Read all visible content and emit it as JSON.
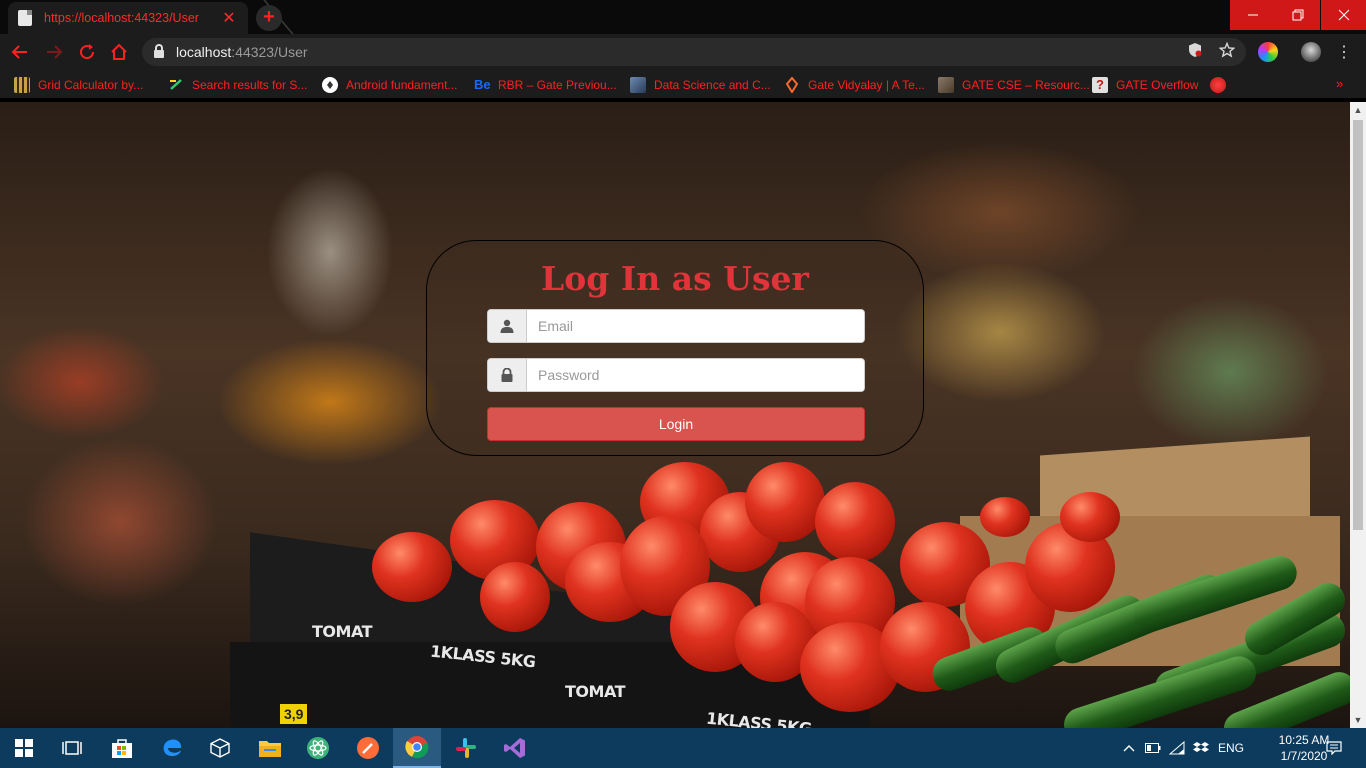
{
  "browser": {
    "tab_title": "https://localhost:44323/User",
    "tab_close": "✕",
    "new_tab": "+",
    "url_host": "localhost",
    "url_rest": ":44323/User",
    "bookmarks": [
      {
        "label": "Grid Calculator by...",
        "color": "#c8a24a"
      },
      {
        "label": "Search results for S...",
        "color": "#2ecc71"
      },
      {
        "label": "Android fundament...",
        "color": "#ffffff"
      },
      {
        "label": "RBR – Gate Previou...",
        "color": "#1769ff"
      },
      {
        "label": "Data Science and C...",
        "color": "#6a8caf"
      },
      {
        "label": "Gate Vidyalay | A Te...",
        "color": "#ff6a2a"
      },
      {
        "label": "GATE CSE – Resourc...",
        "color": "#8a7a6a"
      },
      {
        "label": "GATE Overflow",
        "color": "#e0e0e0"
      }
    ],
    "bookmarks_more": "»"
  },
  "login": {
    "title": "Log In as User",
    "email_placeholder": "Email",
    "password_placeholder": "Password",
    "button_label": "Login",
    "accent": "#e0333a",
    "button_color": "#d9534f"
  },
  "background": {
    "crate_labels": [
      "TOMAT",
      "1KLASS 5KG",
      "TOMAT",
      "1KLASS 5KG"
    ],
    "price_tag": "3,9"
  },
  "taskbar": {
    "language": "ENG",
    "time": "10:25 AM",
    "date": "1/7/2020"
  }
}
